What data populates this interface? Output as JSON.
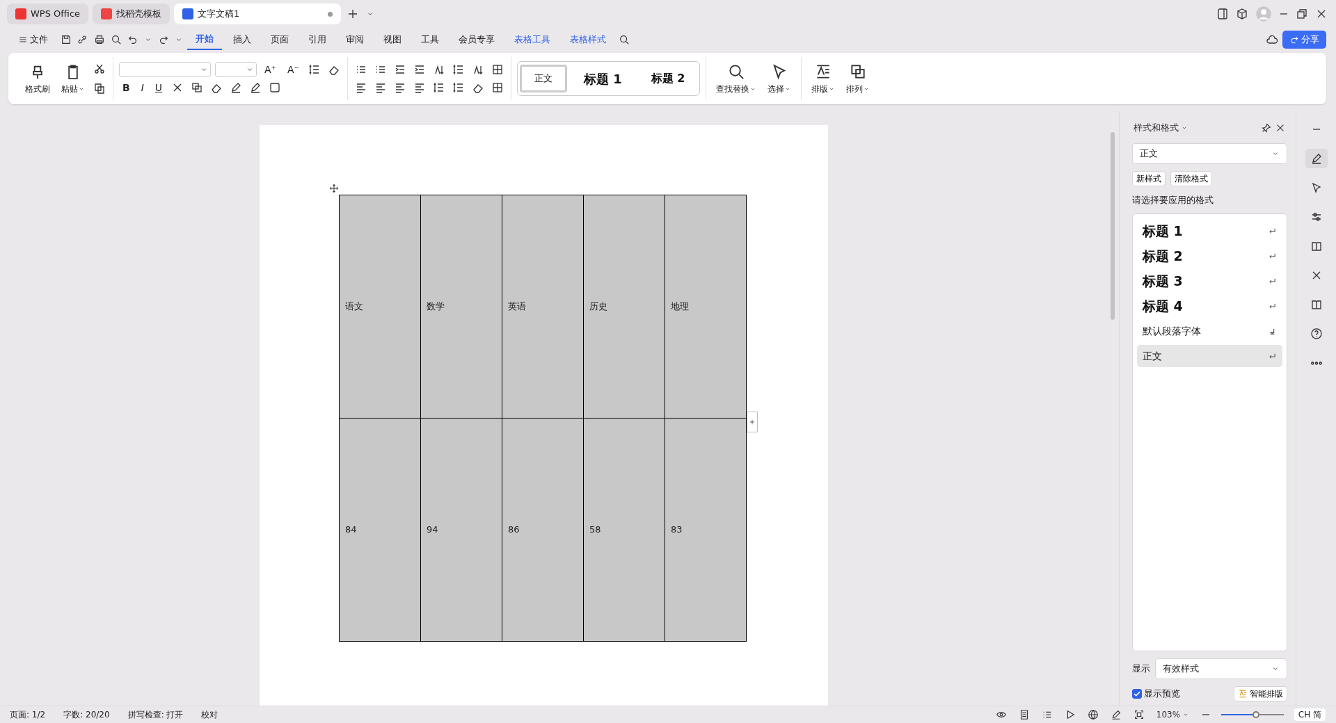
{
  "tabs": [
    {
      "label": "WPS Office",
      "kind": "home",
      "selected": false
    },
    {
      "label": "找稻壳模板",
      "kind": "template",
      "selected": false
    },
    {
      "label": "文字文稿1",
      "kind": "doc",
      "selected": true
    }
  ],
  "menu": {
    "file": "文件",
    "items": [
      {
        "label": "开始",
        "kind": "main",
        "selected": true
      },
      {
        "label": "插入",
        "kind": "main",
        "selected": false
      },
      {
        "label": "页面",
        "kind": "main",
        "selected": false
      },
      {
        "label": "引用",
        "kind": "main",
        "selected": false
      },
      {
        "label": "审阅",
        "kind": "main",
        "selected": false
      },
      {
        "label": "视图",
        "kind": "main",
        "selected": false
      },
      {
        "label": "工具",
        "kind": "main",
        "selected": false
      },
      {
        "label": "会员专享",
        "kind": "main",
        "selected": false
      },
      {
        "label": "表格工具",
        "kind": "context",
        "selected": false
      },
      {
        "label": "表格样式",
        "kind": "context",
        "selected": false
      }
    ],
    "share": "分享"
  },
  "ribbon": {
    "format_painter": "格式刷",
    "paste": "粘贴",
    "glyphs_top": [
      "A⁺",
      "A⁻"
    ],
    "glyphs_bottom": [
      "B",
      "I",
      "U"
    ],
    "styles": [
      {
        "label": "正文",
        "kind": "body",
        "selected": true
      },
      {
        "label": "标题 1",
        "kind": "h1",
        "selected": false
      },
      {
        "label": "标题 2",
        "kind": "h2",
        "selected": false
      }
    ],
    "tools": [
      {
        "label": "查找替换",
        "kind": "find"
      },
      {
        "label": "选择",
        "kind": "select"
      },
      {
        "label": "排版",
        "kind": "layout"
      },
      {
        "label": "排列",
        "kind": "arrange"
      }
    ]
  },
  "table": {
    "rows": [
      [
        "语文",
        "数学",
        "英语",
        "历史",
        "地理"
      ],
      [
        "84",
        "94",
        "86",
        "58",
        "83"
      ]
    ]
  },
  "panel": {
    "title": "样式和格式",
    "current": "正文",
    "buttons": [
      "新样式",
      "清除格式"
    ],
    "hint": "请选择要应用的格式",
    "styles": [
      {
        "label": "标题 1",
        "kind": "heading",
        "selected": false
      },
      {
        "label": "标题 2",
        "kind": "heading",
        "selected": false
      },
      {
        "label": "标题 3",
        "kind": "heading",
        "selected": false
      },
      {
        "label": "标题 4",
        "kind": "heading",
        "selected": false
      },
      {
        "label": "默认段落字体",
        "kind": "character",
        "selected": false
      },
      {
        "label": "正文",
        "kind": "paragraph",
        "selected": true
      }
    ],
    "show_label": "显示",
    "show_value": "有效样式",
    "preview": {
      "label": "显示预览",
      "checked": true
    },
    "smart_button": "智能排版"
  },
  "status_bar": {
    "items": [
      "页面: 1/2",
      "字数: 20/20",
      "拼写检查: 打开",
      "校对"
    ],
    "zoom": "103%",
    "zoom_slider": {
      "level": 0.55
    },
    "ime": [
      "CH",
      "简"
    ]
  }
}
